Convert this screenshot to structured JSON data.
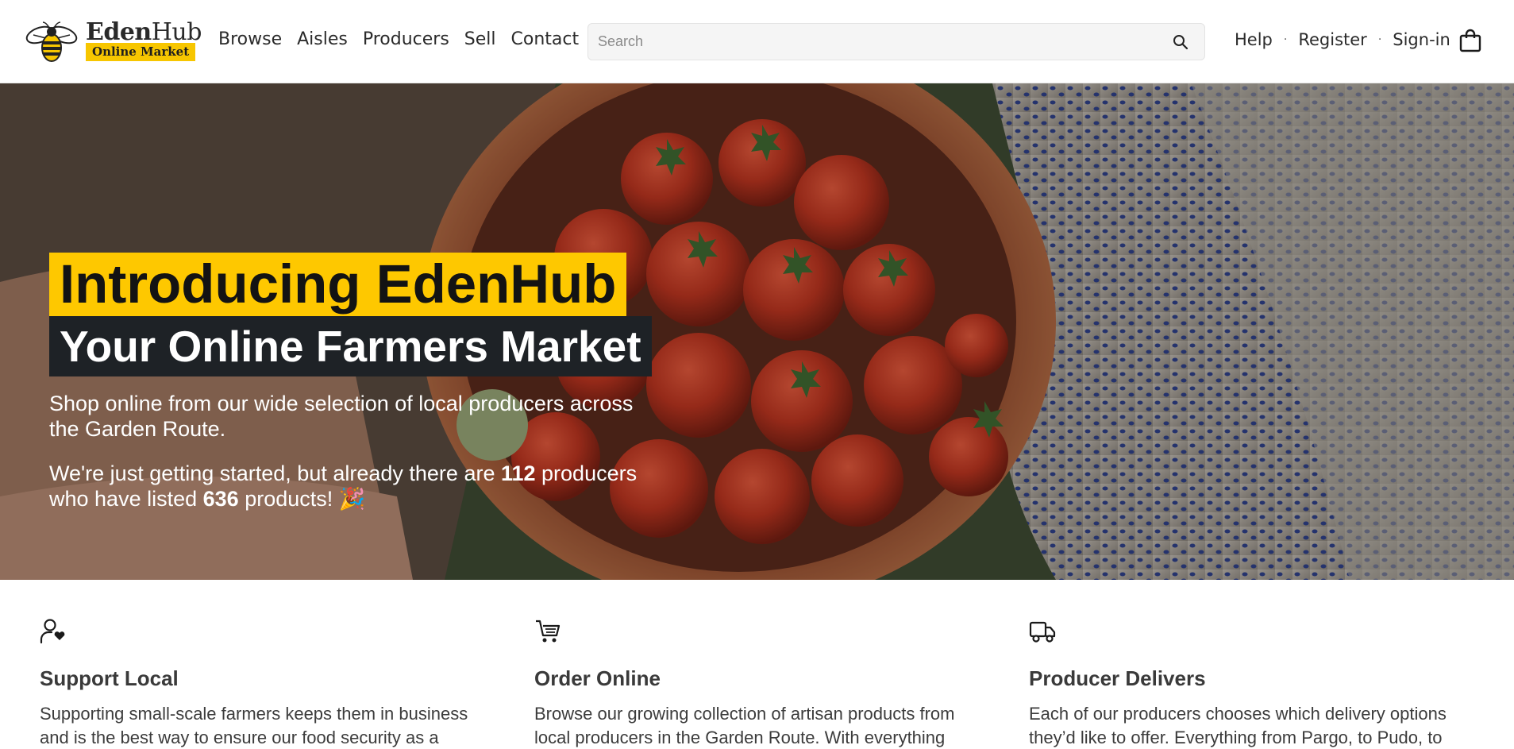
{
  "header": {
    "logo": {
      "name_bold": "Eden",
      "name_rest": "Hub",
      "tagline": "Online Market"
    },
    "nav": [
      "Browse",
      "Aisles",
      "Producers",
      "Sell",
      "Contact"
    ],
    "search": {
      "placeholder": "Search",
      "value": ""
    },
    "account": {
      "help": "Help",
      "register": "Register",
      "signin": "Sign-in",
      "separator": "·"
    },
    "icons": {
      "search": "search-icon",
      "cart": "shopping-bag-icon",
      "logo": "bee-icon"
    }
  },
  "hero": {
    "title_line1": "Introducing EdenHub",
    "title_line2": "Your Online Farmers Market",
    "para1": "Shop online from our wide selection of local producers across the Garden Route.",
    "para2_a": "We're just getting started, but already there are ",
    "producer_count": "112",
    "para2_b": " producers who have listed ",
    "product_count": "636",
    "para2_c": " products! 🎉",
    "colors": {
      "highlight": "#fec800",
      "dark_band": "#1e2226"
    }
  },
  "features": [
    {
      "icon": "user-heart-icon",
      "title": "Support Local",
      "text": "Supporting small-scale farmers keeps them in business and is the best way to ensure our food security as a"
    },
    {
      "icon": "cart-icon",
      "title": "Order Online",
      "text": "Browse our growing collection of artisan products from local producers in the Garden Route. With everything"
    },
    {
      "icon": "truck-icon",
      "title": "Producer Delivers",
      "text": "Each of our producers chooses which delivery options they’d like to offer. Everything from Pargo, to Pudo, to"
    }
  ]
}
